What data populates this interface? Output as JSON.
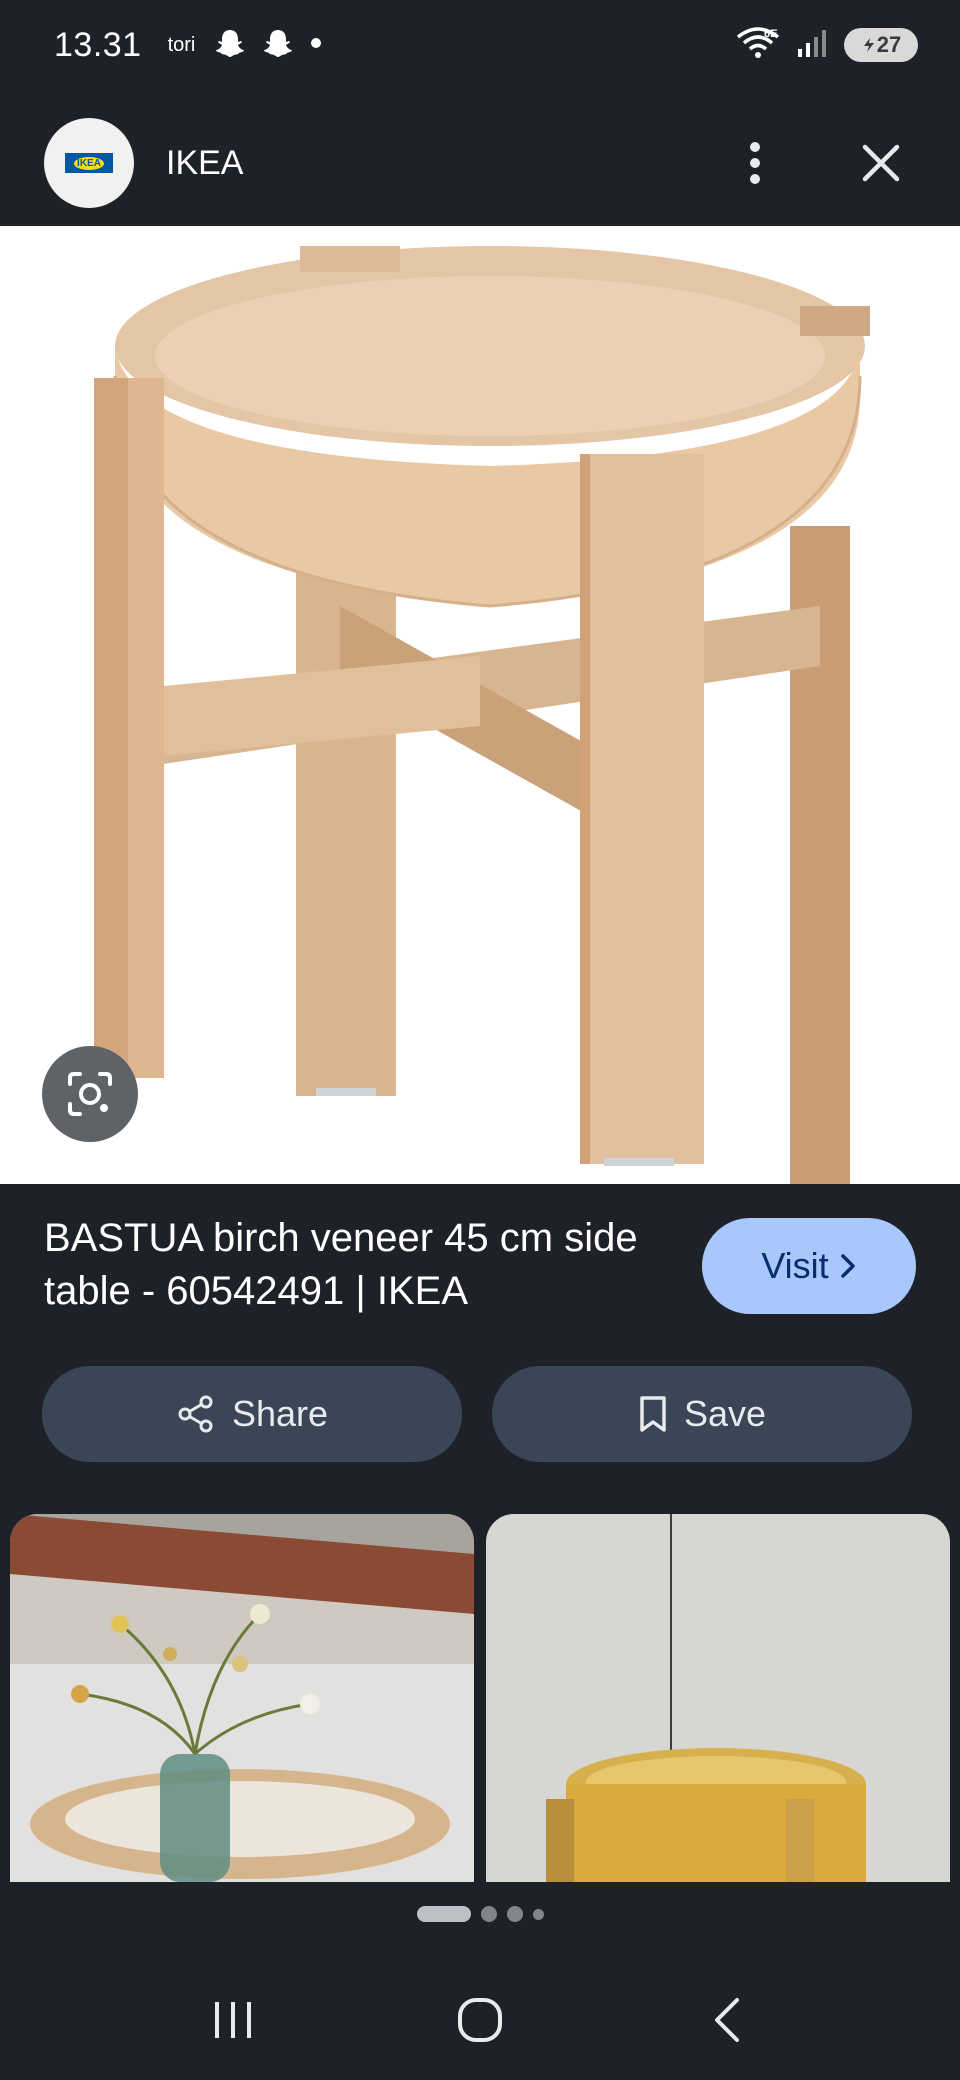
{
  "status_bar": {
    "time": "13.31",
    "carrier": "tori",
    "battery": "27"
  },
  "header": {
    "site_name": "IKEA",
    "logo_text": "IKEA"
  },
  "result": {
    "title": "BASTUA birch veneer 45 cm side table - 60542491 | IKEA",
    "visit_label": "Visit"
  },
  "actions": {
    "share_label": "Share",
    "save_label": "Save"
  },
  "related_count": 2,
  "pager": {
    "pages": 4,
    "current": 1
  },
  "colors": {
    "background": "#1f2128",
    "visit_button": "#a8c7fa",
    "action_button": "#3b4558"
  }
}
